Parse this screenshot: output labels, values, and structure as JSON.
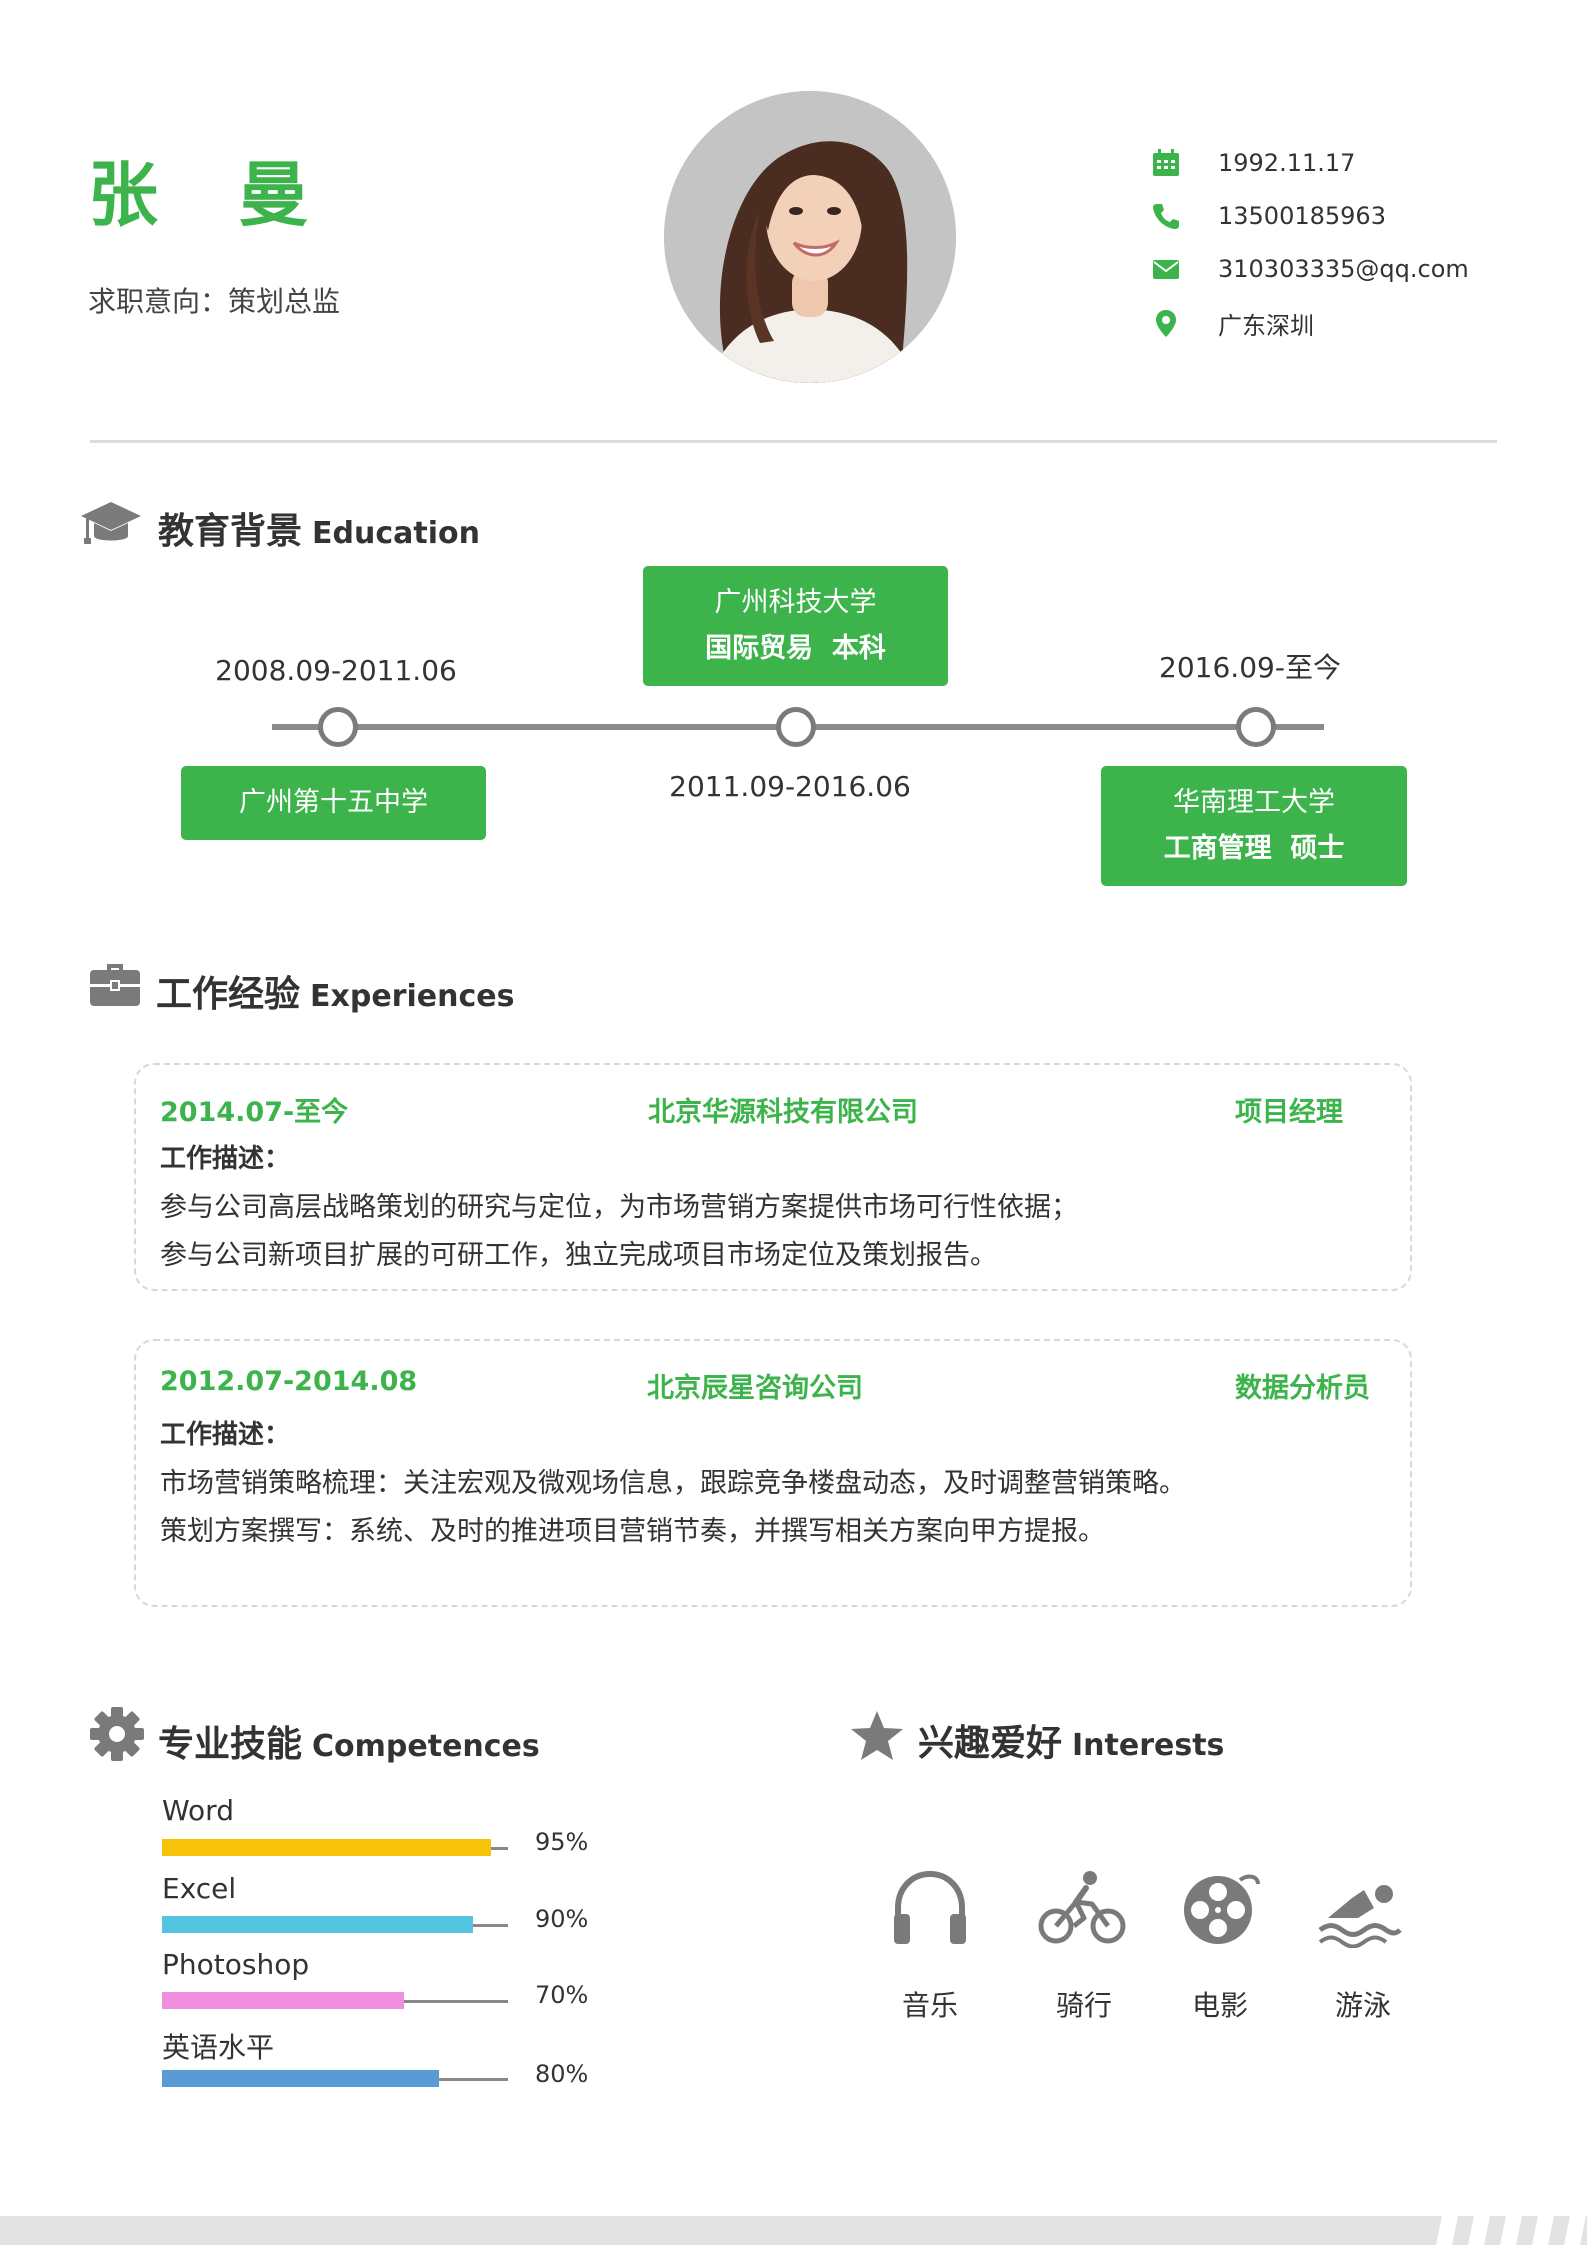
{
  "header": {
    "name": "张 曼",
    "intent": "求职意向：策划总监",
    "contacts": {
      "birthday": "1992.11.17",
      "phone": "13500185963",
      "email": "310303335@qq.com",
      "location": "广东深圳"
    }
  },
  "icons": {
    "birthday": "calendar-icon",
    "phone": "phone-icon",
    "email": "envelope-icon",
    "location": "map-pin-icon",
    "education": "graduation-cap-icon",
    "experience": "briefcase-icon",
    "skills": "gear-icon",
    "interests": "star-icon"
  },
  "colors": {
    "accent": "#3cb44b",
    "word": "#f8c20a",
    "excel": "#55c4e0",
    "photoshop": "#f08fe0",
    "english": "#5b9bd5"
  },
  "education": {
    "title": "教育背景",
    "title_en": "Education",
    "items": [
      {
        "date": "2008.09-2011.06",
        "school": "广州第十五中学"
      },
      {
        "date": "2011.09-2016.06",
        "school": "广州科技大学",
        "detail": "国际贸易  本科"
      },
      {
        "date": "2016.09-至今",
        "school": "华南理工大学",
        "detail": "工商管理  硕士"
      }
    ]
  },
  "experience": {
    "title": "工作经验",
    "title_en": "Experiences",
    "items": [
      {
        "period": "2014.07-至今",
        "company": "北京华源科技有限公司",
        "role": "项目经理",
        "label": "工作描述：",
        "lines": [
          "参与公司高层战略策划的研究与定位，为市场营销方案提供市场可行性依据；",
          "参与公司新项目扩展的可研工作，独立完成项目市场定位及策划报告。"
        ]
      },
      {
        "period": "2012.07-2014.08",
        "company": "北京辰星咨询公司",
        "role": "数据分析员",
        "label": "工作描述：",
        "lines": [
          "市场营销策略梳理：关注宏观及微观场信息，跟踪竞争楼盘动态，及时调整营销策略。",
          "策划方案撰写：系统、及时的推进项目营销节奏，并撰写相关方案向甲方提报。"
        ]
      }
    ]
  },
  "skills": {
    "title": "专业技能",
    "title_en": "Competences",
    "items": [
      {
        "name": "Word",
        "percent_label": "95%",
        "value": 95,
        "color": "#f8c20a"
      },
      {
        "name": "Excel",
        "percent_label": "90%",
        "value": 90,
        "color": "#55c4e0"
      },
      {
        "name": "Photoshop",
        "percent_label": "70%",
        "value": 70,
        "color": "#f08fe0"
      },
      {
        "name": "英语水平",
        "percent_label": "80%",
        "value": 80,
        "color": "#5b9bd5"
      }
    ]
  },
  "interests": {
    "title": "兴趣爱好",
    "title_en": "Interests",
    "items": [
      {
        "label": "音乐",
        "icon": "headphones-icon"
      },
      {
        "label": "骑行",
        "icon": "cycling-icon"
      },
      {
        "label": "电影",
        "icon": "film-reel-icon"
      },
      {
        "label": "游泳",
        "icon": "swimming-icon"
      }
    ]
  }
}
